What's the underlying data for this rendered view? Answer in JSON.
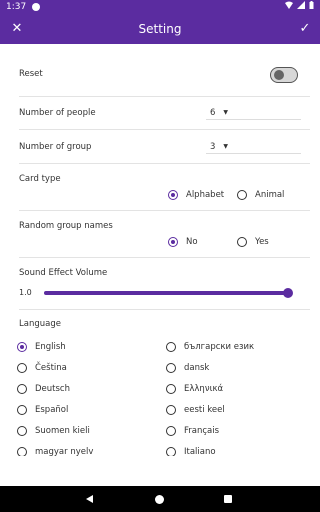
{
  "status_bar": {
    "time": "1:37"
  },
  "app_bar": {
    "title": "Setting",
    "close_symbol": "✕",
    "confirm_symbol": "✓"
  },
  "settings": {
    "reset_label": "Reset",
    "reset_enabled": false,
    "people_label": "Number of people",
    "people_value": "6",
    "group_label": "Number of group",
    "group_value": "3",
    "card_type_label": "Card type",
    "card_type_options": [
      "Alphabet",
      "Animal"
    ],
    "card_type_selected": "Alphabet",
    "random_names_label": "Random group names",
    "random_names_options": [
      "No",
      "Yes"
    ],
    "random_names_selected": "No",
    "volume_label": "Sound Effect Volume",
    "volume_value": "1.0",
    "volume_fraction": 1.0
  },
  "language": {
    "label": "Language",
    "selected": "English",
    "left": [
      "English",
      "Čeština",
      "Deutsch",
      "Español",
      "Suomen kieli",
      "magyar nyelv"
    ],
    "right": [
      "български език",
      "dansk",
      "Ελληνικά",
      "eesti keel",
      "Français",
      "Italiano"
    ]
  },
  "colors": {
    "primary": "#5b2ca0",
    "navigation": "#000000"
  }
}
